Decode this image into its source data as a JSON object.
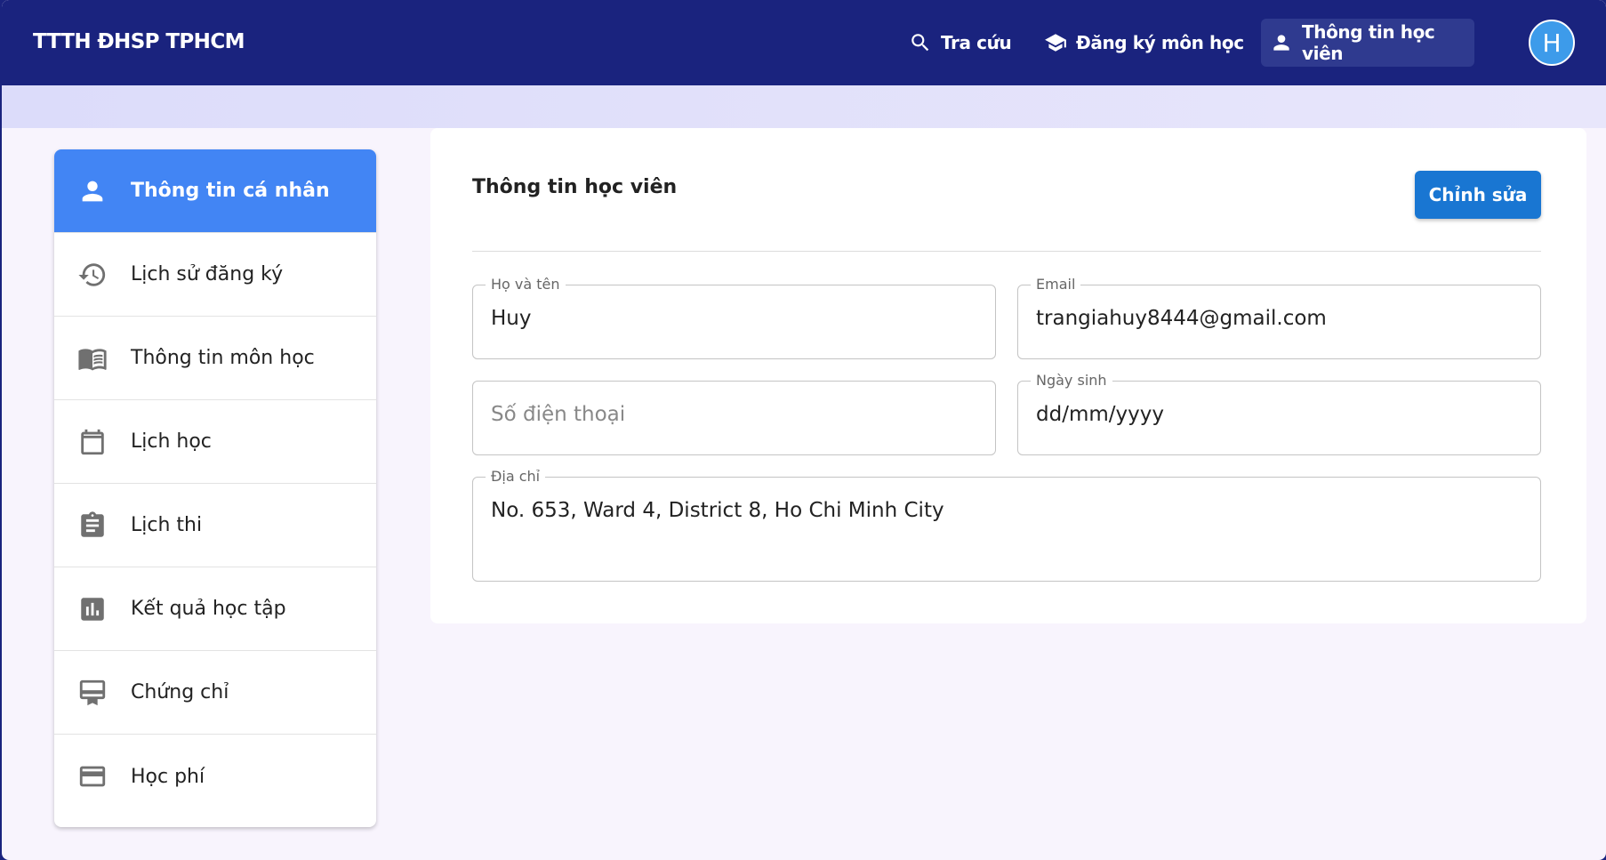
{
  "header": {
    "brand": "TTTH ĐHSP TPHCM",
    "nav": [
      {
        "label": "Tra cứu",
        "icon": "search-icon"
      },
      {
        "label": "Đăng ký môn học",
        "icon": "graduation-cap-icon"
      },
      {
        "label": "Thông tin học viên",
        "icon": "person-icon",
        "active": true
      }
    ],
    "avatar_initial": "H"
  },
  "sidebar": {
    "items": [
      {
        "label": "Thông tin cá nhân",
        "icon": "person-icon",
        "active": true
      },
      {
        "label": "Lịch sử đăng ký",
        "icon": "history-icon"
      },
      {
        "label": "Thông tin môn học",
        "icon": "book-icon"
      },
      {
        "label": "Lịch học",
        "icon": "calendar-icon"
      },
      {
        "label": "Lịch thi",
        "icon": "clipboard-icon"
      },
      {
        "label": "Kết quả học tập",
        "icon": "bar-chart-icon"
      },
      {
        "label": "Chứng chỉ",
        "icon": "certificate-icon"
      },
      {
        "label": "Học phí",
        "icon": "credit-card-icon"
      }
    ]
  },
  "main": {
    "title": "Thông tin học viên",
    "edit_label": "Chỉnh sửa",
    "fields": {
      "name": {
        "label": "Họ và tên",
        "value": "Huy"
      },
      "email": {
        "label": "Email",
        "value": "trangiahuy8444@gmail.com"
      },
      "phone": {
        "placeholder": "Số điện thoại"
      },
      "dob": {
        "label": "Ngày sinh",
        "value": "dd/mm/yyyy"
      },
      "address": {
        "label": "Địa chỉ",
        "value": "No. 653, Ward 4, District 8, Ho Chi Minh City"
      }
    }
  },
  "colors": {
    "header_bg": "#1a237e",
    "sidebar_active": "#4285f4",
    "button": "#1976d2",
    "avatar": "#3d9bea"
  }
}
